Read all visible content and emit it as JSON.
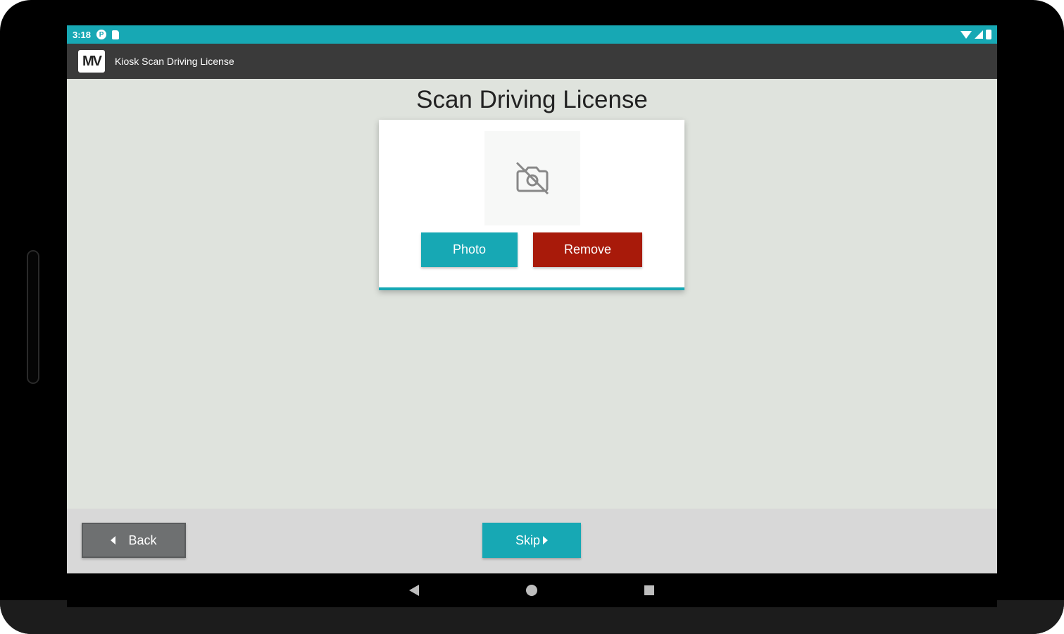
{
  "status_bar": {
    "time": "3:18",
    "icons": [
      "circle-p-icon",
      "sd-card-icon",
      "wifi-icon",
      "signal-icon",
      "battery-icon"
    ]
  },
  "app_bar": {
    "logo_text": "MV",
    "title": "Kiosk Scan Driving License"
  },
  "main": {
    "title": "Scan Driving License",
    "preview_icon": "no-photo-camera-icon",
    "photo_label": "Photo",
    "remove_label": "Remove"
  },
  "footer": {
    "back_label": "Back",
    "skip_label": "Skip"
  },
  "nav": {
    "icons": [
      "back-triangle-icon",
      "home-circle-icon",
      "recents-square-icon"
    ]
  },
  "colors": {
    "accent": "#17a8b4",
    "danger": "#a81a0a",
    "back_button": "#6e7071",
    "app_bar": "#3a3a3a",
    "background": "#dfe3dd"
  }
}
